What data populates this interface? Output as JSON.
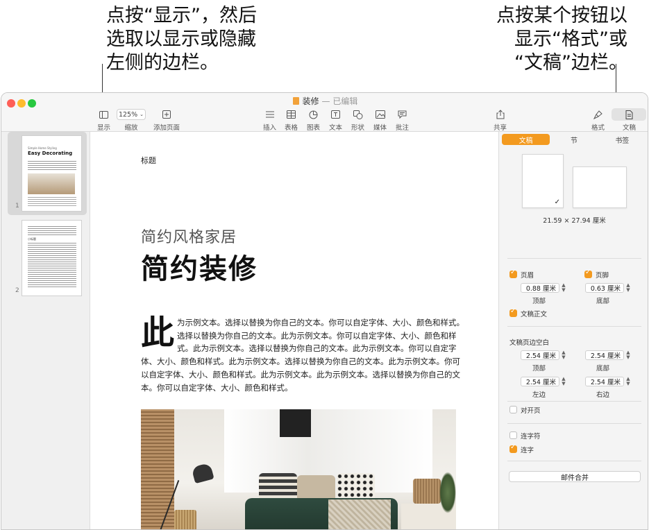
{
  "callouts": {
    "left": "点按“显示”，然后\n选取以显示或隐藏\n左侧的边栏。",
    "right": "点按某个按钮以\n显示“格式”或\n“文稿”边栏。"
  },
  "window": {
    "doc_name": "装修",
    "separator": "—",
    "status": "已编辑"
  },
  "toolbar": {
    "view": "显示",
    "zoom": "缩放",
    "zoom_value": "125%",
    "add_page": "添加页面",
    "insert": "插入",
    "table": "表格",
    "chart": "图表",
    "text": "文本",
    "shape": "形状",
    "media": "媒体",
    "comment": "批注",
    "share": "共享",
    "format": "格式",
    "document": "文稿"
  },
  "sidebar": {
    "pages": [
      {
        "number": "1",
        "kicker": "Simple Home Styling",
        "heading": "Easy Decorating"
      },
      {
        "number": "2",
        "kicker": "",
        "heading": "小标题"
      }
    ]
  },
  "document": {
    "header": "标题",
    "subtitle": "简约风格家居",
    "title": "简约装修",
    "dropcap": "此",
    "body": "为示例文本。选择以替换为你自己的文本。你可以自定字体、大小、颜色和样式。选择以替换为你自己的文本。此为示例文本。你可以自定字体、大小、颜色和样式。此为示例文本。选择以替换为你自己的文本。此为示例文本。你可以自定字体、大小、颜色和样式。此为示例文本。选择以替换为你自己的文本。此为示例文本。你可以自定字体、大小、颜色和样式。此为示例文本。此为示例文本。选择以替换为你自己的文本。你可以自定字体、大小、颜色和样式。"
  },
  "inspector": {
    "tabs": [
      "文稿",
      "节",
      "书签"
    ],
    "active_tab": "文稿",
    "paper_size": "21.59 × 27.94 厘米",
    "header_label": "页眉",
    "footer_label": "页脚",
    "header_value": "0.88 厘米",
    "footer_value": "0.63 厘米",
    "top_label": "顶部",
    "bottom_label": "底部",
    "body_label": "文稿正文",
    "margins_heading": "文稿页边空白",
    "margin_top": "2.54 厘米",
    "margin_bottom": "2.54 厘米",
    "margin_left": "2.54 厘米",
    "margin_right": "2.54 厘米",
    "left_label": "左边",
    "right_label": "右边",
    "facing_pages": "对开页",
    "hyphenation": "连字符",
    "ligatures": "连字",
    "mail_merge": "邮件合并"
  }
}
